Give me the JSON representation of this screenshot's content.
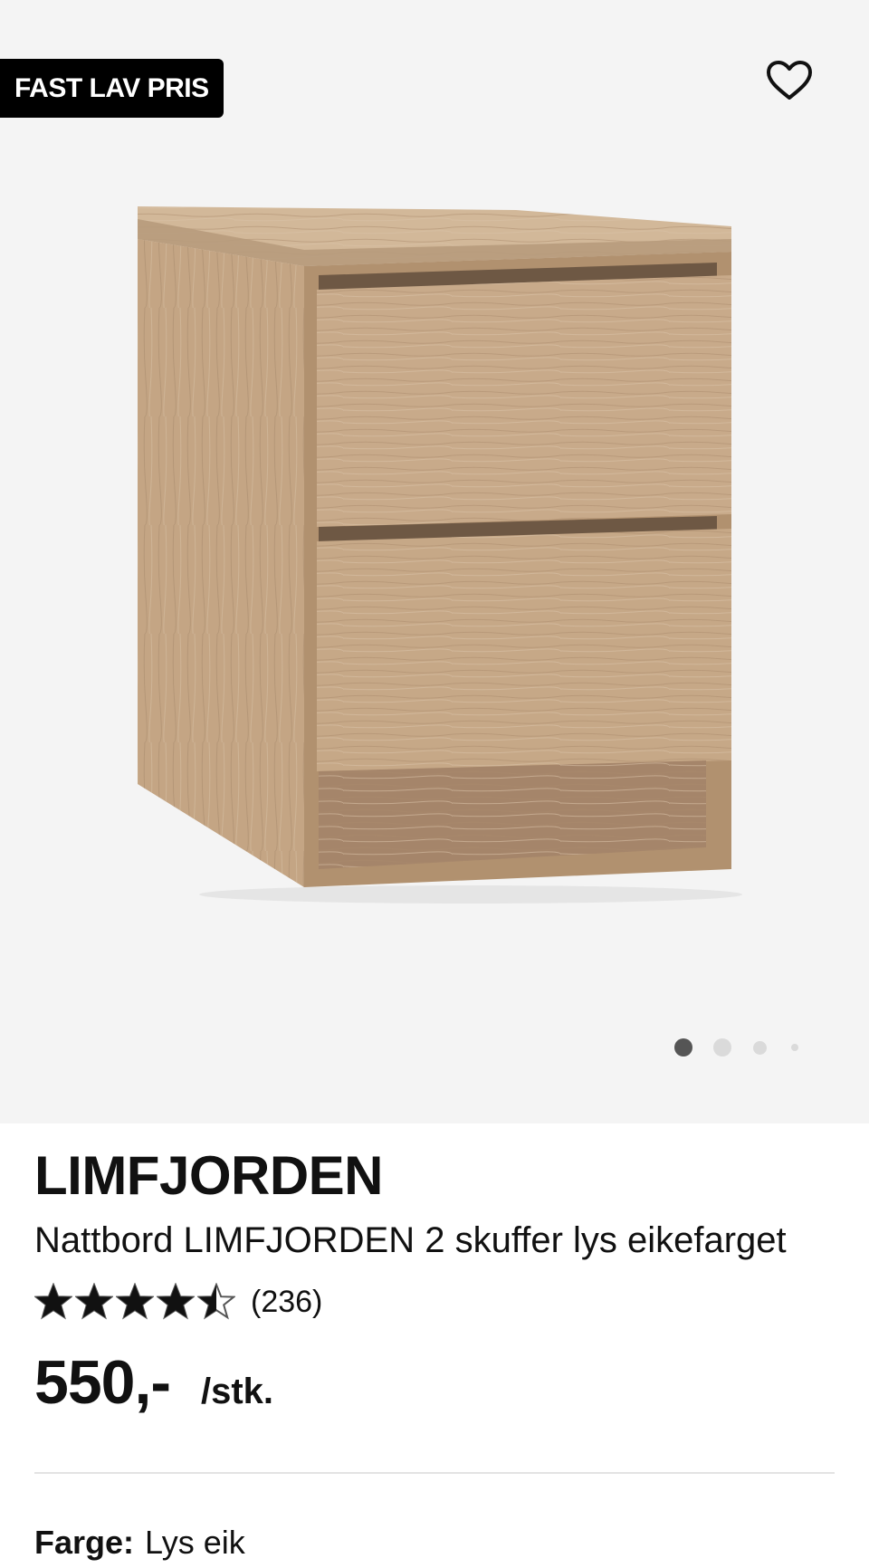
{
  "gallery": {
    "badge": "FAST LAV PRIS",
    "favorite_icon": "heart-outline-icon",
    "image_alt": "Nattbord LIMFJORDEN 2 skuffer lys eikefarget",
    "slide_count": 4,
    "active_slide": 1
  },
  "product": {
    "brand": "LIMFJORDEN",
    "description": "Nattbord LIMFJORDEN 2 skuffer lys eikefarget",
    "rating": 4.5,
    "rating_max": 5,
    "review_count": "(236)",
    "price": "550,-",
    "unit": "/stk.",
    "color_label": "Farge:",
    "color_value": "Lys eik"
  },
  "colors": {
    "background_gallery": "#f4f4f4",
    "badge_bg": "#000000",
    "text": "#111111",
    "dot_active": "#555555",
    "dot_inactive": "#dadada",
    "wood_light": "#c9ad8d",
    "wood_mid": "#b8997a",
    "wood_dark": "#6e5844"
  }
}
